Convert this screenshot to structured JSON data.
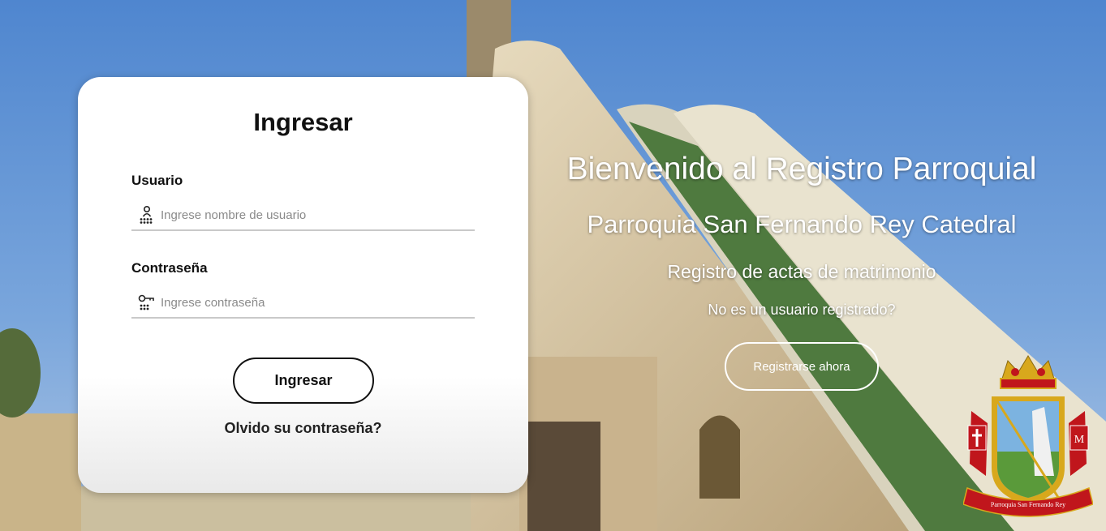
{
  "login": {
    "title": "Ingresar",
    "username_label": "Usuario",
    "username_placeholder": "Ingrese nombre de usuario",
    "username_icon": "user-icon",
    "password_label": "Contraseña",
    "password_placeholder": "Ingrese contraseña",
    "password_icon": "key-icon",
    "submit_label": "Ingresar",
    "forgot_label": "Olvido su contraseña?"
  },
  "welcome": {
    "title": "Bienvenido al Registro Parroquial",
    "parish": "Parroquia San Fernando Rey Catedral",
    "registry": "Registro de actas de matrimonio",
    "question": "No es un usuario registrado?",
    "register_label": "Registrarse ahora"
  },
  "crest": {
    "icon": "parish-crest-logo",
    "ribbon_text": "Parroquia San Fernando Rey"
  },
  "colors": {
    "sky": "#5d8fd0",
    "card": "#ffffff",
    "text_dark": "#111111",
    "crest_red": "#c0161c",
    "crest_gold": "#d8a81c"
  }
}
